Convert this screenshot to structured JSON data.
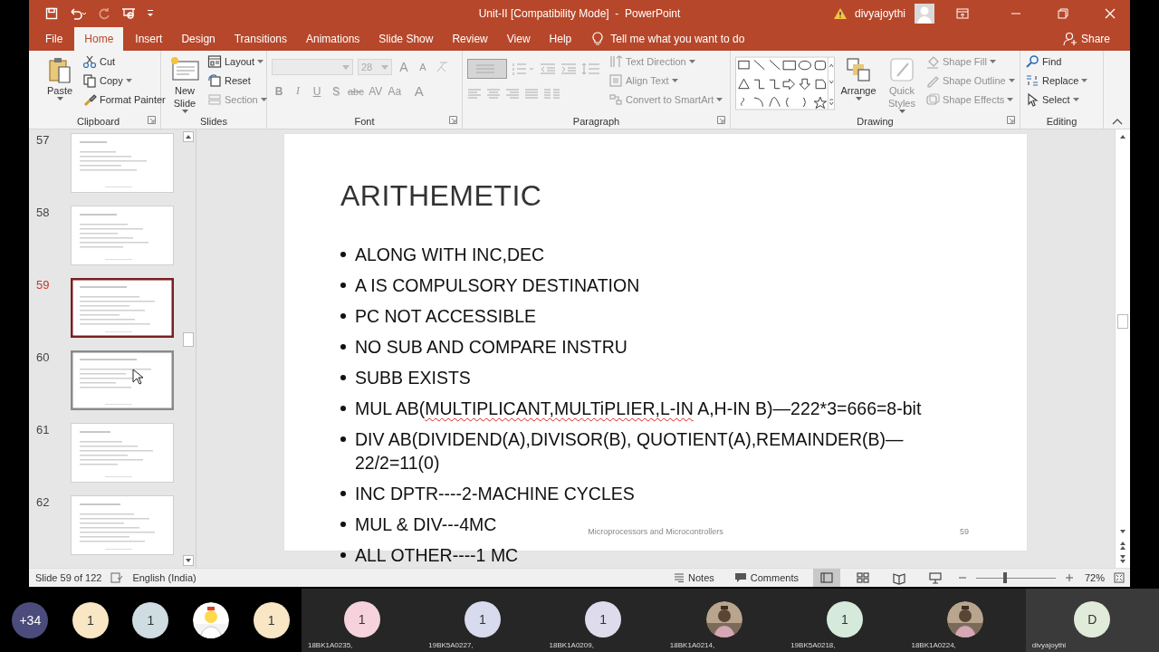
{
  "title_bar": {
    "title": "Unit-II [Compatibility Mode]  -  PowerPoint",
    "user": "divyajoythi"
  },
  "tabs": [
    {
      "label": "File",
      "selected": false
    },
    {
      "label": "Home",
      "selected": true
    },
    {
      "label": "Insert",
      "selected": false
    },
    {
      "label": "Design",
      "selected": false
    },
    {
      "label": "Transitions",
      "selected": false
    },
    {
      "label": "Animations",
      "selected": false
    },
    {
      "label": "Slide Show",
      "selected": false
    },
    {
      "label": "Review",
      "selected": false
    },
    {
      "label": "View",
      "selected": false
    },
    {
      "label": "Help",
      "selected": false
    }
  ],
  "tell_me": "Tell me what you want to do",
  "share": "Share",
  "ribbon": {
    "groups": [
      {
        "kind": "clipboard",
        "label": "Clipboard",
        "launcher": true,
        "large": [
          {
            "label": "Paste",
            "menu": true,
            "disabled": false
          }
        ],
        "commands": [
          {
            "label": "Cut",
            "menu": false,
            "disabled": false
          },
          {
            "label": "Copy",
            "menu": true,
            "disabled": false
          },
          {
            "label": "Format Painter",
            "menu": false,
            "disabled": false
          }
        ]
      },
      {
        "kind": "slides",
        "label": "Slides",
        "launcher": false,
        "large": [
          {
            "label": "New Slide",
            "menu": true,
            "disabled": false
          }
        ],
        "commands": [
          {
            "label": "Layout",
            "menu": true,
            "disabled": false
          },
          {
            "label": "Reset",
            "menu": false,
            "disabled": false
          },
          {
            "label": "Section",
            "menu": true,
            "disabled": true
          }
        ]
      },
      {
        "kind": "font",
        "label": "Font",
        "launcher": true,
        "font_size": "28",
        "size_buttons": [
          "A",
          "A"
        ],
        "format_buttons": [
          "B",
          "I",
          "U",
          "S",
          "abc",
          "AV",
          "Aa",
          "A"
        ]
      },
      {
        "kind": "paragraph",
        "label": "Paragraph",
        "launcher": true,
        "commands": [
          {
            "label": "Text Direction",
            "menu": true,
            "disabled": true
          },
          {
            "label": "Align Text",
            "menu": true,
            "disabled": true
          },
          {
            "label": "Convert to SmartArt",
            "menu": true,
            "disabled": true
          }
        ]
      },
      {
        "kind": "drawing",
        "label": "Drawing",
        "launcher": true,
        "large": [
          {
            "label": "Arrange",
            "menu": true,
            "disabled": false
          },
          {
            "label": "Quick Styles",
            "menu": true,
            "disabled": true
          }
        ],
        "commands": [
          {
            "label": "Shape Fill",
            "menu": true,
            "disabled": true
          },
          {
            "label": "Shape Outline",
            "menu": true,
            "disabled": true
          },
          {
            "label": "Shape Effects",
            "menu": true,
            "disabled": true
          }
        ]
      },
      {
        "kind": "editing",
        "label": "Editing",
        "launcher": false,
        "commands": [
          {
            "label": "Find",
            "menu": false,
            "disabled": false
          },
          {
            "label": "Replace",
            "menu": true,
            "disabled": false
          },
          {
            "label": "Select",
            "menu": true,
            "disabled": false
          }
        ]
      }
    ]
  },
  "thumbnails": [
    {
      "number": "57",
      "selected": false,
      "hovered": false
    },
    {
      "number": "58",
      "selected": false,
      "hovered": false
    },
    {
      "number": "59",
      "selected": true,
      "hovered": false
    },
    {
      "number": "60",
      "selected": false,
      "hovered": true
    },
    {
      "number": "61",
      "selected": false,
      "hovered": false
    },
    {
      "number": "62",
      "selected": false,
      "hovered": false
    }
  ],
  "slide": {
    "title": "ARITHEMETIC",
    "bullets": [
      {
        "segments": [
          {
            "text": "ALONG WITH INC,DEC",
            "misspelled": false
          }
        ]
      },
      {
        "segments": [
          {
            "text": "A IS COMPULSORY DESTINATION",
            "misspelled": false
          }
        ]
      },
      {
        "segments": [
          {
            "text": "PC NOT ACCESSIBLE",
            "misspelled": false
          }
        ]
      },
      {
        "segments": [
          {
            "text": "NO SUB AND COMPARE INSTRU",
            "misspelled": false
          }
        ]
      },
      {
        "segments": [
          {
            "text": "SUBB EXISTS",
            "misspelled": false
          }
        ]
      },
      {
        "segments": [
          {
            "text": "MUL AB(",
            "misspelled": false
          },
          {
            "text": "MULTIPLICANT,MULTiPLIER,L-IN",
            "misspelled": true
          },
          {
            "text": " A,H-IN B)—222*3=666=8-bit",
            "misspelled": false
          }
        ]
      },
      {
        "segments": [
          {
            "text": "DIV AB(DIVIDEND(A),DIVISOR(B), QUOTIENT(A),REMAINDER(B)—22/2=11(0)",
            "misspelled": false
          }
        ]
      },
      {
        "segments": [
          {
            "text": "INC DPTR----2-MACHINE CYCLES",
            "misspelled": false
          }
        ]
      },
      {
        "segments": [
          {
            "text": "MUL & DIV---4MC",
            "misspelled": false
          }
        ]
      },
      {
        "segments": [
          {
            "text": "ALL OTHER----1 MC",
            "misspelled": false
          }
        ]
      }
    ],
    "footer": "Microprocessors and Microcontrollers",
    "number": "59"
  },
  "status_bar": {
    "slide_counter": "Slide 59 of 122",
    "language": "English (India)",
    "notes": "Notes",
    "comments": "Comments",
    "views": [
      {
        "selected": true
      },
      {
        "selected": false
      },
      {
        "selected": false
      },
      {
        "selected": false
      }
    ],
    "zoom": {
      "level": 0.36,
      "reading": "72%"
    }
  },
  "participants": [
    {
      "kind": "avatar",
      "label": "+34",
      "color": "#4b4c7c",
      "selected": false
    },
    {
      "kind": "avatar",
      "label": "1",
      "color": "#f8e6c4",
      "selected": false
    },
    {
      "kind": "avatar",
      "label": "1",
      "color": "#cfdce2",
      "selected": false
    },
    {
      "kind": "picture",
      "selected": false
    },
    {
      "kind": "avatar",
      "label": "1",
      "color": "#f8e6c4",
      "selected": false
    },
    {
      "kind": "avatar",
      "label": "1",
      "color": "#f6d3dc",
      "name": "18BK1A0235,",
      "selected": false
    },
    {
      "kind": "avatar",
      "label": "1",
      "color": "#d8daee",
      "name": "19BK5A0227,",
      "selected": false
    },
    {
      "kind": "avatar",
      "label": "1",
      "color": "#dedcec",
      "name": "18BK1A0209,",
      "selected": false
    },
    {
      "kind": "picture",
      "name": "18BK1A0214,",
      "selected": false
    },
    {
      "kind": "avatar",
      "label": "1",
      "color": "#d5eadb",
      "name": "19BK5A0218,",
      "selected": false
    },
    {
      "kind": "picture",
      "name": "18BK1A0224,",
      "selected": false
    },
    {
      "kind": "avatar",
      "label": "D",
      "color": "#e1ebd9",
      "name": "divyajoythi",
      "selected": true
    }
  ]
}
